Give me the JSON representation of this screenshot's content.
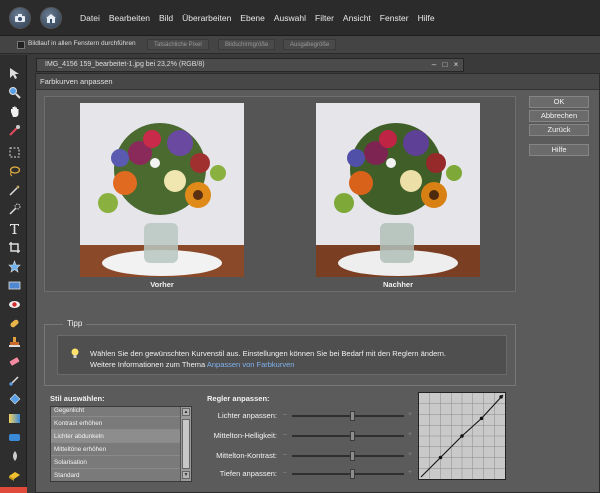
{
  "menu": {
    "items": [
      "Datei",
      "Bearbeiten",
      "Bild",
      "Überarbeiten",
      "Ebene",
      "Auswahl",
      "Filter",
      "Ansicht",
      "Fenster",
      "Hilfe"
    ]
  },
  "options_bar": {
    "scroll_all_label": "Bildlauf in allen Fenstern durchführen",
    "buttons": [
      "Tatsächliche Pixel",
      "Bildschirmgröße",
      "Ausgabegröße"
    ]
  },
  "document": {
    "tab_title": "IMG_4156 159_bearbeitet-1.jpg bei 23,2% (RGB/8)"
  },
  "dialog": {
    "title": "Farbkurven anpassen",
    "before_label": "Vorher",
    "after_label": "Nachher",
    "buttons": {
      "ok": "OK",
      "cancel": "Abbrechen",
      "reset": "Zurück",
      "help": "Hilfe"
    },
    "tip": {
      "legend": "Tipp",
      "line1": "Wählen Sie den gewünschten Kurvenstil aus. Einstellungen können Sie bei Bedarf mit den Reglern ändern.",
      "line2_prefix": "Weitere Informationen zum Thema ",
      "line2_link": "Anpassen von Farbkurven"
    },
    "style_label": "Stil auswählen:",
    "styles": [
      "Gegenlicht",
      "Kontrast erhöhen",
      "Lichter abdunkeln",
      "Mitteltöne erhöhen",
      "Solarisation",
      "Standard"
    ],
    "selected_style_index": 2,
    "regler_label": "Regler anpassen:",
    "sliders": [
      {
        "label": "Lichter anpassen:",
        "value": 0.54
      },
      {
        "label": "Mittelton-Helligkeit:",
        "value": 0.54
      },
      {
        "label": "Mittelton-Kontrast:",
        "value": 0.54
      },
      {
        "label": "Tiefen anpassen:",
        "value": 0.54
      }
    ]
  },
  "colors": {
    "accent_link": "#7fb2ee",
    "dialog_bg": "#5b5b5b",
    "menubar_bg": "#2b2b2b"
  },
  "tools": [
    "move-icon",
    "zoom-icon",
    "hand-icon",
    "eyedropper-icon",
    "marquee-icon",
    "lasso-icon",
    "magic-wand-icon",
    "quick-selection-icon",
    "type-icon",
    "crop-icon",
    "cookie-cutter-icon",
    "straighten-icon",
    "red-eye-icon",
    "healing-brush-icon",
    "clone-stamp-icon",
    "eraser-icon",
    "brush-icon",
    "paint-bucket-icon",
    "gradient-icon",
    "shape-icon",
    "blur-icon",
    "sponge-icon"
  ]
}
